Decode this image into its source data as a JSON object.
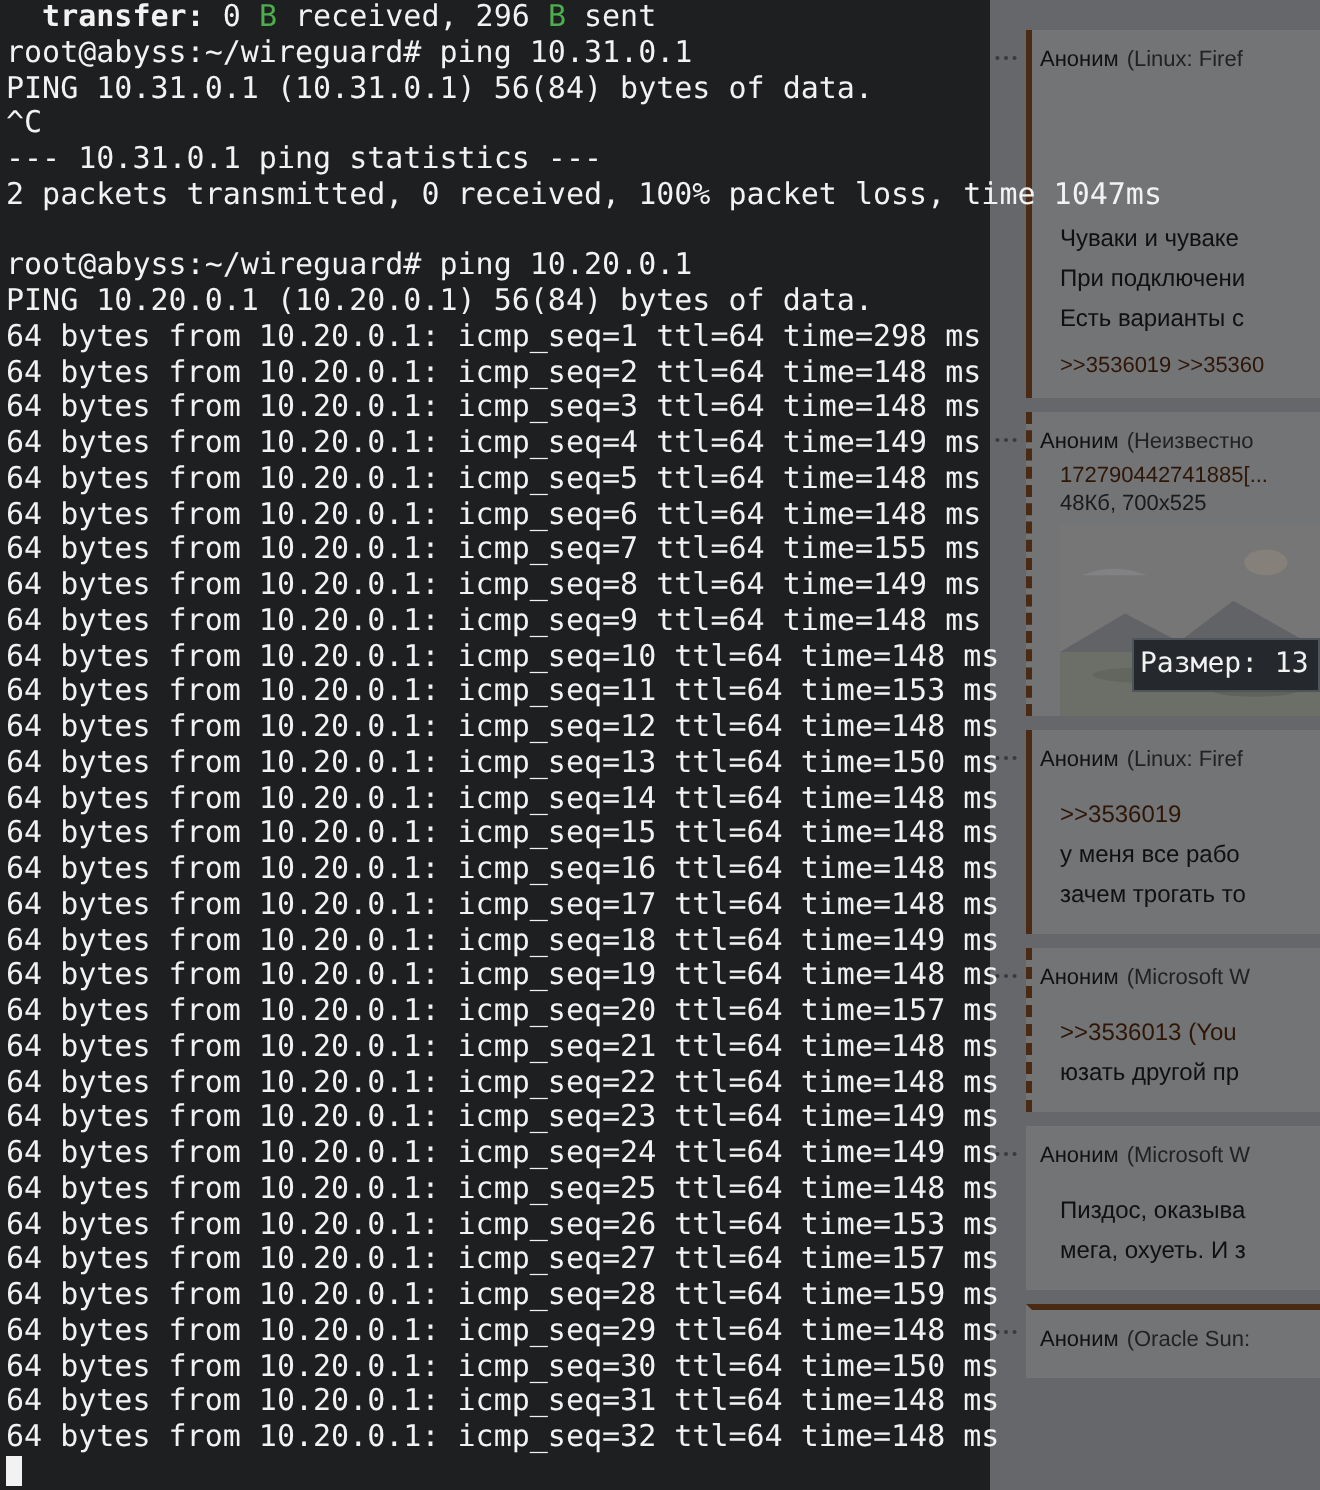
{
  "terminal": {
    "partial_line": [
      {
        "text": "  transfer:",
        "kind": "bold"
      },
      {
        "text": " 0 ",
        "kind": "plain"
      },
      {
        "text": "B",
        "kind": "green"
      },
      {
        "text": " received, 296 ",
        "kind": "plain"
      },
      {
        "text": "B",
        "kind": "green"
      },
      {
        "text": " sent",
        "kind": "plain"
      }
    ],
    "blocks": [
      [
        "root@abyss:~/wireguard# ping 10.31.0.1",
        "PING 10.31.0.1 (10.31.0.1) 56(84) bytes of data.",
        "^C",
        "--- 10.31.0.1 ping statistics ---",
        "2 packets transmitted, 0 received, 100% packet loss, time 1047ms"
      ],
      [
        "root@abyss:~/wireguard# ping 10.20.0.1",
        "PING 10.20.0.1 (10.20.0.1) 56(84) bytes of data.",
        "64 bytes from 10.20.0.1: icmp_seq=1 ttl=64 time=298 ms",
        "64 bytes from 10.20.0.1: icmp_seq=2 ttl=64 time=148 ms",
        "64 bytes from 10.20.0.1: icmp_seq=3 ttl=64 time=148 ms",
        "64 bytes from 10.20.0.1: icmp_seq=4 ttl=64 time=149 ms",
        "64 bytes from 10.20.0.1: icmp_seq=5 ttl=64 time=148 ms",
        "64 bytes from 10.20.0.1: icmp_seq=6 ttl=64 time=148 ms",
        "64 bytes from 10.20.0.1: icmp_seq=7 ttl=64 time=155 ms",
        "64 bytes from 10.20.0.1: icmp_seq=8 ttl=64 time=149 ms",
        "64 bytes from 10.20.0.1: icmp_seq=9 ttl=64 time=148 ms",
        "64 bytes from 10.20.0.1: icmp_seq=10 ttl=64 time=148 ms",
        "64 bytes from 10.20.0.1: icmp_seq=11 ttl=64 time=153 ms",
        "64 bytes from 10.20.0.1: icmp_seq=12 ttl=64 time=148 ms",
        "64 bytes from 10.20.0.1: icmp_seq=13 ttl=64 time=150 ms",
        "64 bytes from 10.20.0.1: icmp_seq=14 ttl=64 time=148 ms",
        "64 bytes from 10.20.0.1: icmp_seq=15 ttl=64 time=148 ms",
        "64 bytes from 10.20.0.1: icmp_seq=16 ttl=64 time=148 ms",
        "64 bytes from 10.20.0.1: icmp_seq=17 ttl=64 time=148 ms",
        "64 bytes from 10.20.0.1: icmp_seq=18 ttl=64 time=149 ms",
        "64 bytes from 10.20.0.1: icmp_seq=19 ttl=64 time=148 ms",
        "64 bytes from 10.20.0.1: icmp_seq=20 ttl=64 time=157 ms",
        "64 bytes from 10.20.0.1: icmp_seq=21 ttl=64 time=148 ms",
        "64 bytes from 10.20.0.1: icmp_seq=22 ttl=64 time=148 ms",
        "64 bytes from 10.20.0.1: icmp_seq=23 ttl=64 time=149 ms",
        "64 bytes from 10.20.0.1: icmp_seq=24 ttl=64 time=149 ms",
        "64 bytes from 10.20.0.1: icmp_seq=25 ttl=64 time=148 ms",
        "64 bytes from 10.20.0.1: icmp_seq=26 ttl=64 time=153 ms",
        "64 bytes from 10.20.0.1: icmp_seq=27 ttl=64 time=157 ms",
        "64 bytes from 10.20.0.1: icmp_seq=28 ttl=64 time=159 ms",
        "64 bytes from 10.20.0.1: icmp_seq=29 ttl=64 time=148 ms",
        "64 bytes from 10.20.0.1: icmp_seq=30 ttl=64 time=150 ms",
        "64 bytes from 10.20.0.1: icmp_seq=31 ttl=64 time=148 ms",
        "64 bytes from 10.20.0.1: icmp_seq=32 ttl=64 time=148 ms"
      ]
    ]
  },
  "posts": [
    {
      "kind": "solid",
      "author": "Аноним",
      "meta": "(Linux: Firef",
      "body": [
        {
          "kind": "text",
          "text": "Чуваки и чуваке"
        },
        {
          "kind": "text",
          "text": "При подключени"
        },
        {
          "kind": "text",
          "text": "Есть варианты с"
        }
      ],
      "replies": ">>3536019 >>35360"
    },
    {
      "kind": "dashed",
      "author": "Аноним",
      "meta": "(Неизвестно",
      "file": {
        "name": "172790442741885[...",
        "info": "48Кб, 700x525"
      }
    },
    {
      "kind": "solid",
      "author": "Аноним",
      "meta": "(Linux: Firef",
      "body": [
        {
          "kind": "link",
          "text": ">>3536019"
        },
        {
          "kind": "text",
          "text": "у меня все рабо"
        },
        {
          "kind": "text",
          "text": "зачем трогать то"
        }
      ]
    },
    {
      "kind": "dashed",
      "author": "Аноним",
      "meta": "(Microsoft W",
      "body": [
        {
          "kind": "link",
          "text": ">>3536013 (You"
        },
        {
          "kind": "text",
          "text": "юзать другой пр"
        }
      ]
    },
    {
      "kind": "plain",
      "author": "Аноним",
      "meta": "(Microsoft W",
      "body": [
        {
          "kind": "text",
          "text": "Пиздос, оказыва"
        },
        {
          "kind": "text",
          "text": "мега, охуеть. И з"
        }
      ]
    },
    {
      "kind": "topline",
      "author": "Аноним",
      "meta": "(Oracle Sun:"
    }
  ],
  "tooltip": {
    "text": "Размер: 13"
  }
}
